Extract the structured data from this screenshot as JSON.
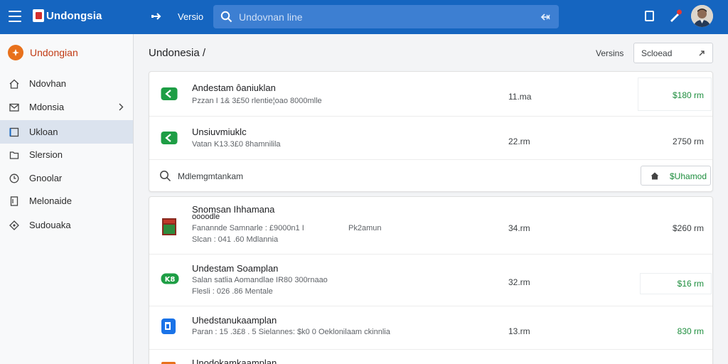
{
  "app": {
    "title": "Undongsia",
    "nav_version": "Versio",
    "search_placeholder": "Undovnan line"
  },
  "sidebar": {
    "brand": "Undongian",
    "items": [
      {
        "label": "Ndovhan",
        "icon": "home-icon"
      },
      {
        "label": "Mdonsia",
        "icon": "mail-icon",
        "has_chevron": true
      },
      {
        "label": "Ukloan",
        "icon": "folder-icon",
        "active": true
      },
      {
        "label": "Slersion",
        "icon": "file-icon"
      },
      {
        "label": "Gnoolar",
        "icon": "clock-icon"
      },
      {
        "label": "Melonaide",
        "icon": "document-icon"
      },
      {
        "label": "Sudouaka",
        "icon": "diamond-icon"
      }
    ]
  },
  "main": {
    "title": "Undonesia /",
    "versions_label": "Versins",
    "select_value": "Scloead"
  },
  "card1": {
    "rows": [
      {
        "title": "Andestam ôaniuklan",
        "sub": "Pzzan  I 1& 3£50  rlentie¦oao  8000mlle",
        "qty": "11.ma",
        "price": "$180 rm",
        "price_green": true,
        "icon": "app-icon-green"
      },
      {
        "title": "Unsiuvmiuklc",
        "sub": "Vatan  K13.3£0  8hamnilila",
        "qty": "22.rm",
        "price": "2750 rm",
        "price_green": false,
        "icon": "app-icon-green"
      }
    ],
    "search_placeholder": "Mdlemgmtankam",
    "action_label": "$Uhamod"
  },
  "card2": {
    "rows": [
      {
        "title": "Snomsan  Ihhamana",
        "title2": "oooodle",
        "sub": "Fanannde  Samnarle : £9000n1 I",
        "sub2": "Slcan : 041 .60  Mdlannia",
        "mid": "Pk2amun",
        "qty": "34.rm",
        "price": "$260 rm",
        "price_green": false,
        "icon": "book-icon"
      },
      {
        "title": "Undestam  Soamplan",
        "sub": "Salan  satlia  Aomandlae  IR80 300rnaao",
        "sub2": "Flesli : 026 .86  Mentale",
        "qty": "32.rm",
        "price": "$16 rm",
        "price_green": true,
        "icon": "app-icon-green-k"
      },
      {
        "title": "Uhedstanukaamplan",
        "sub": "Paran  : 15 .3£8 . 5  Sielannes:  $k0 0  Oeklonilaam  ckinnlia",
        "qty": "13.rm",
        "price": "830 rm",
        "price_green": true,
        "icon": "app-icon-blue"
      },
      {
        "title": "Unodokamkaamplan",
        "qty": "",
        "price": "",
        "icon": "app-icon-orange"
      }
    ]
  },
  "colors": {
    "topbar": "#1565c0",
    "accent_green": "#1e8e3e",
    "brand_orange": "#e8711c"
  }
}
